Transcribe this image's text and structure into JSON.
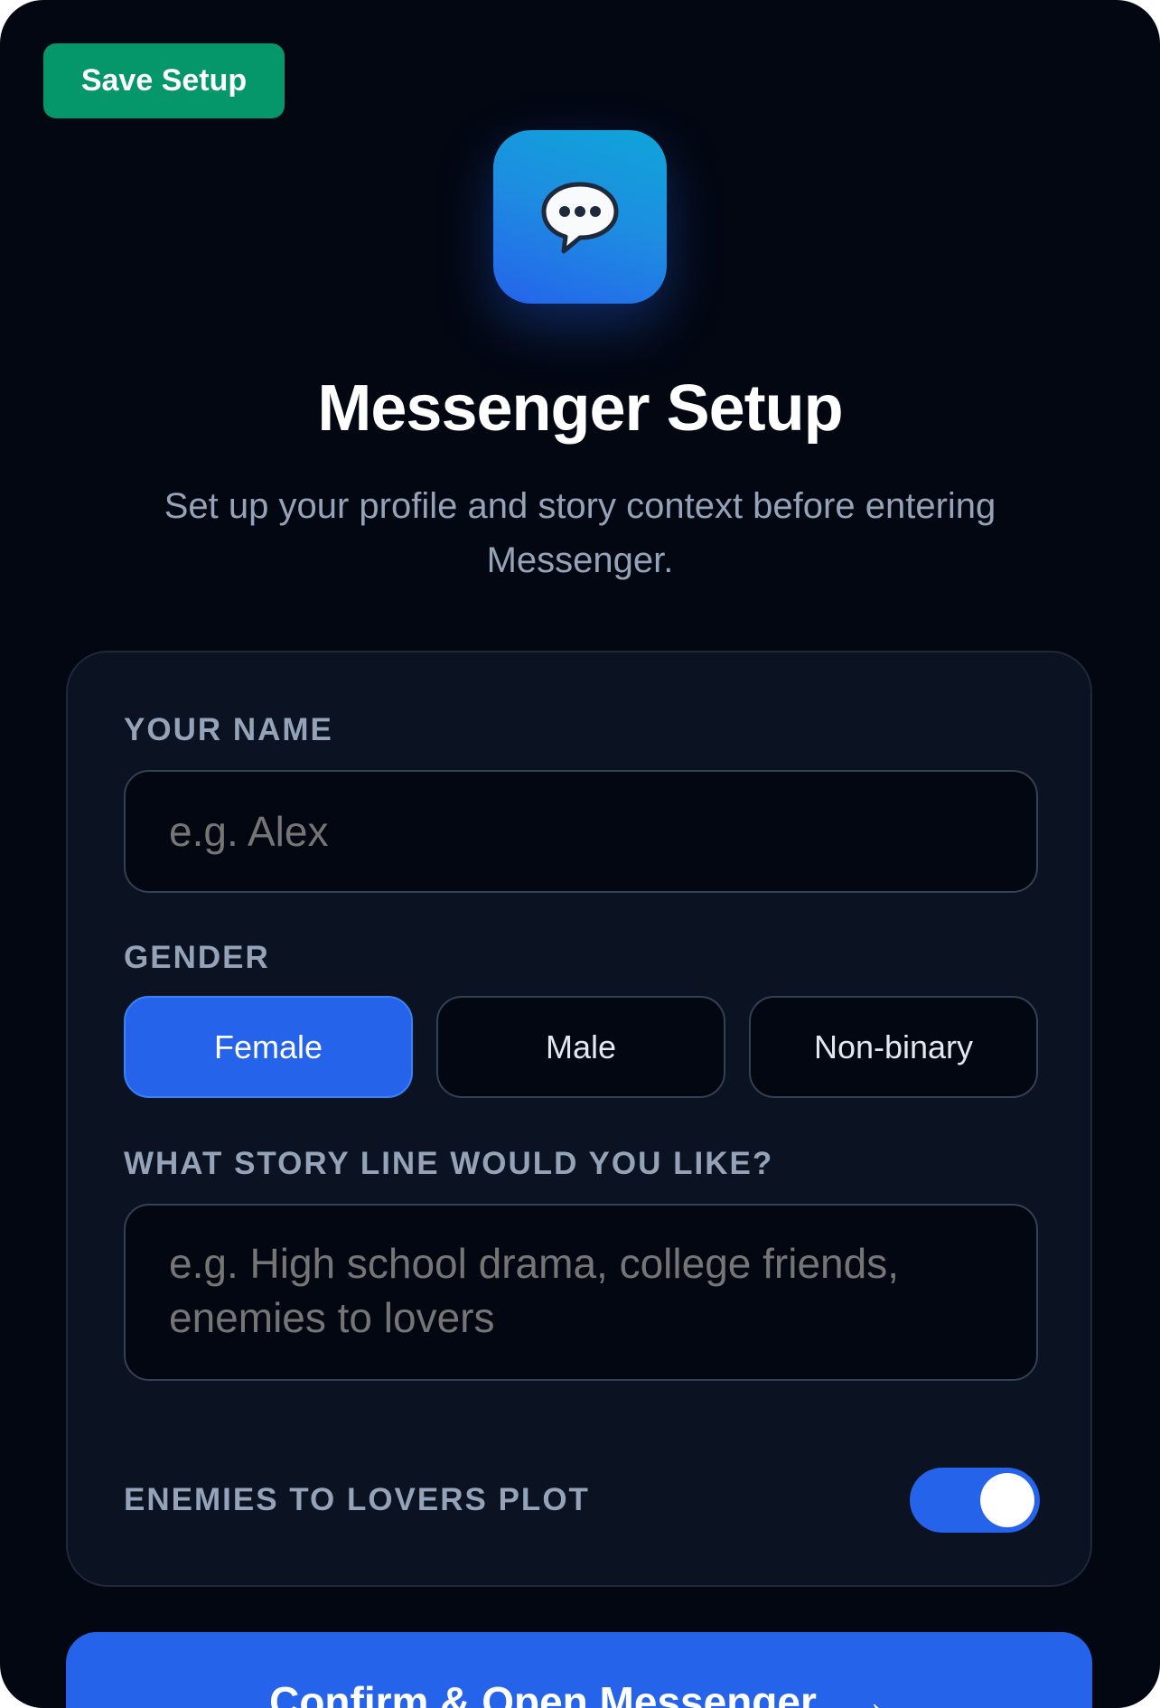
{
  "header": {
    "save_label": "Save Setup",
    "app_icon": "speech-bubble-icon",
    "title": "Messenger Setup",
    "subtitle": "Set up your profile and story context before entering Messenger."
  },
  "form": {
    "name": {
      "label": "YOUR NAME",
      "value": "",
      "placeholder": "e.g. Alex"
    },
    "gender": {
      "label": "GENDER",
      "options": [
        "Female",
        "Male",
        "Non-binary"
      ],
      "selected": "Female"
    },
    "storyline": {
      "label": "WHAT STORY LINE WOULD YOU LIKE?",
      "value": "",
      "placeholder": "e.g. High school drama, college friends, enemies to lovers"
    },
    "enemies_to_lovers": {
      "label": "ENEMIES TO LOVERS PLOT",
      "enabled": true
    }
  },
  "footer": {
    "confirm_label": "Confirm & Open Messenger",
    "confirm_icon": "arrow-right-icon"
  },
  "colors": {
    "background": "#030712",
    "card": "#0b1222",
    "accent": "#2563eb",
    "save": "#059669"
  }
}
